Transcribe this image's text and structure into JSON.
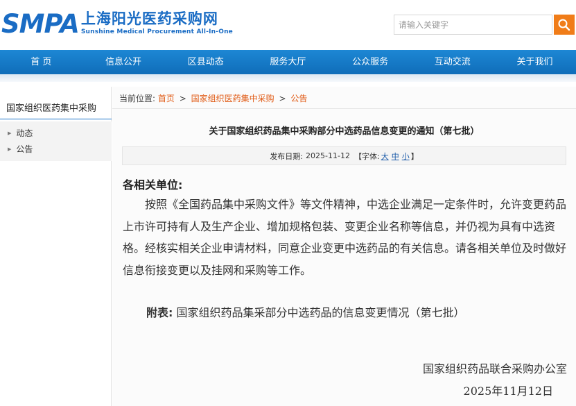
{
  "header": {
    "logo_text": "SMPA",
    "logo_cn": "上海阳光医药采购网",
    "logo_en": "Sunshine Medical Procurement All-In-One"
  },
  "search": {
    "placeholder": "请输入关键字",
    "icon": "search-icon"
  },
  "nav": {
    "items": [
      {
        "label": "首 页"
      },
      {
        "label": "信息公开"
      },
      {
        "label": "区县动态"
      },
      {
        "label": "服务大厅"
      },
      {
        "label": "公众服务"
      },
      {
        "label": "互动交流"
      },
      {
        "label": "关于我们"
      }
    ]
  },
  "sidebar": {
    "title": "国家组织医药集中采购",
    "items": [
      {
        "label": "动态"
      },
      {
        "label": "公告"
      }
    ]
  },
  "breadcrumb": {
    "prefix": "当前位置:",
    "items": [
      {
        "label": "首页"
      },
      {
        "label": "国家组织医药集中采购"
      },
      {
        "label": "公告"
      }
    ],
    "separator": ">"
  },
  "article": {
    "title": "关于国家组织药品集中采购部分中选药品信息变更的通知（第七批）",
    "publish_label": "发布日期:",
    "publish_date": "2025-11-12",
    "font_label_open": "【字体:",
    "font_large": "大",
    "font_medium": "中",
    "font_small": "小",
    "font_label_close": "】",
    "salutation": "各相关单位:",
    "body": "按照《全国药品集中采购文件》等文件精神，中选企业满足一定条件时，允许变更药品上市许可持有人及生产企业、增加规格包装、变更企业名称等信息，并仍视为具有中选资格。经核实相关企业申请材料，同意企业变更中选药品的有关信息。请各相关单位及时做好信息衔接变更以及挂网和采购等工作。",
    "attachment_label": "附表:",
    "attachment_text": "国家组织药品集采部分中选药品的信息变更情况（第七批）",
    "signature_org": "国家组织药品联合采购办公室",
    "signature_date": "2025年11月12日"
  },
  "colors": {
    "brand_blue": "#1a6cc4",
    "nav_blue": "#1478c6",
    "accent_orange": "#f07c18",
    "link_orange": "#e05a14"
  }
}
